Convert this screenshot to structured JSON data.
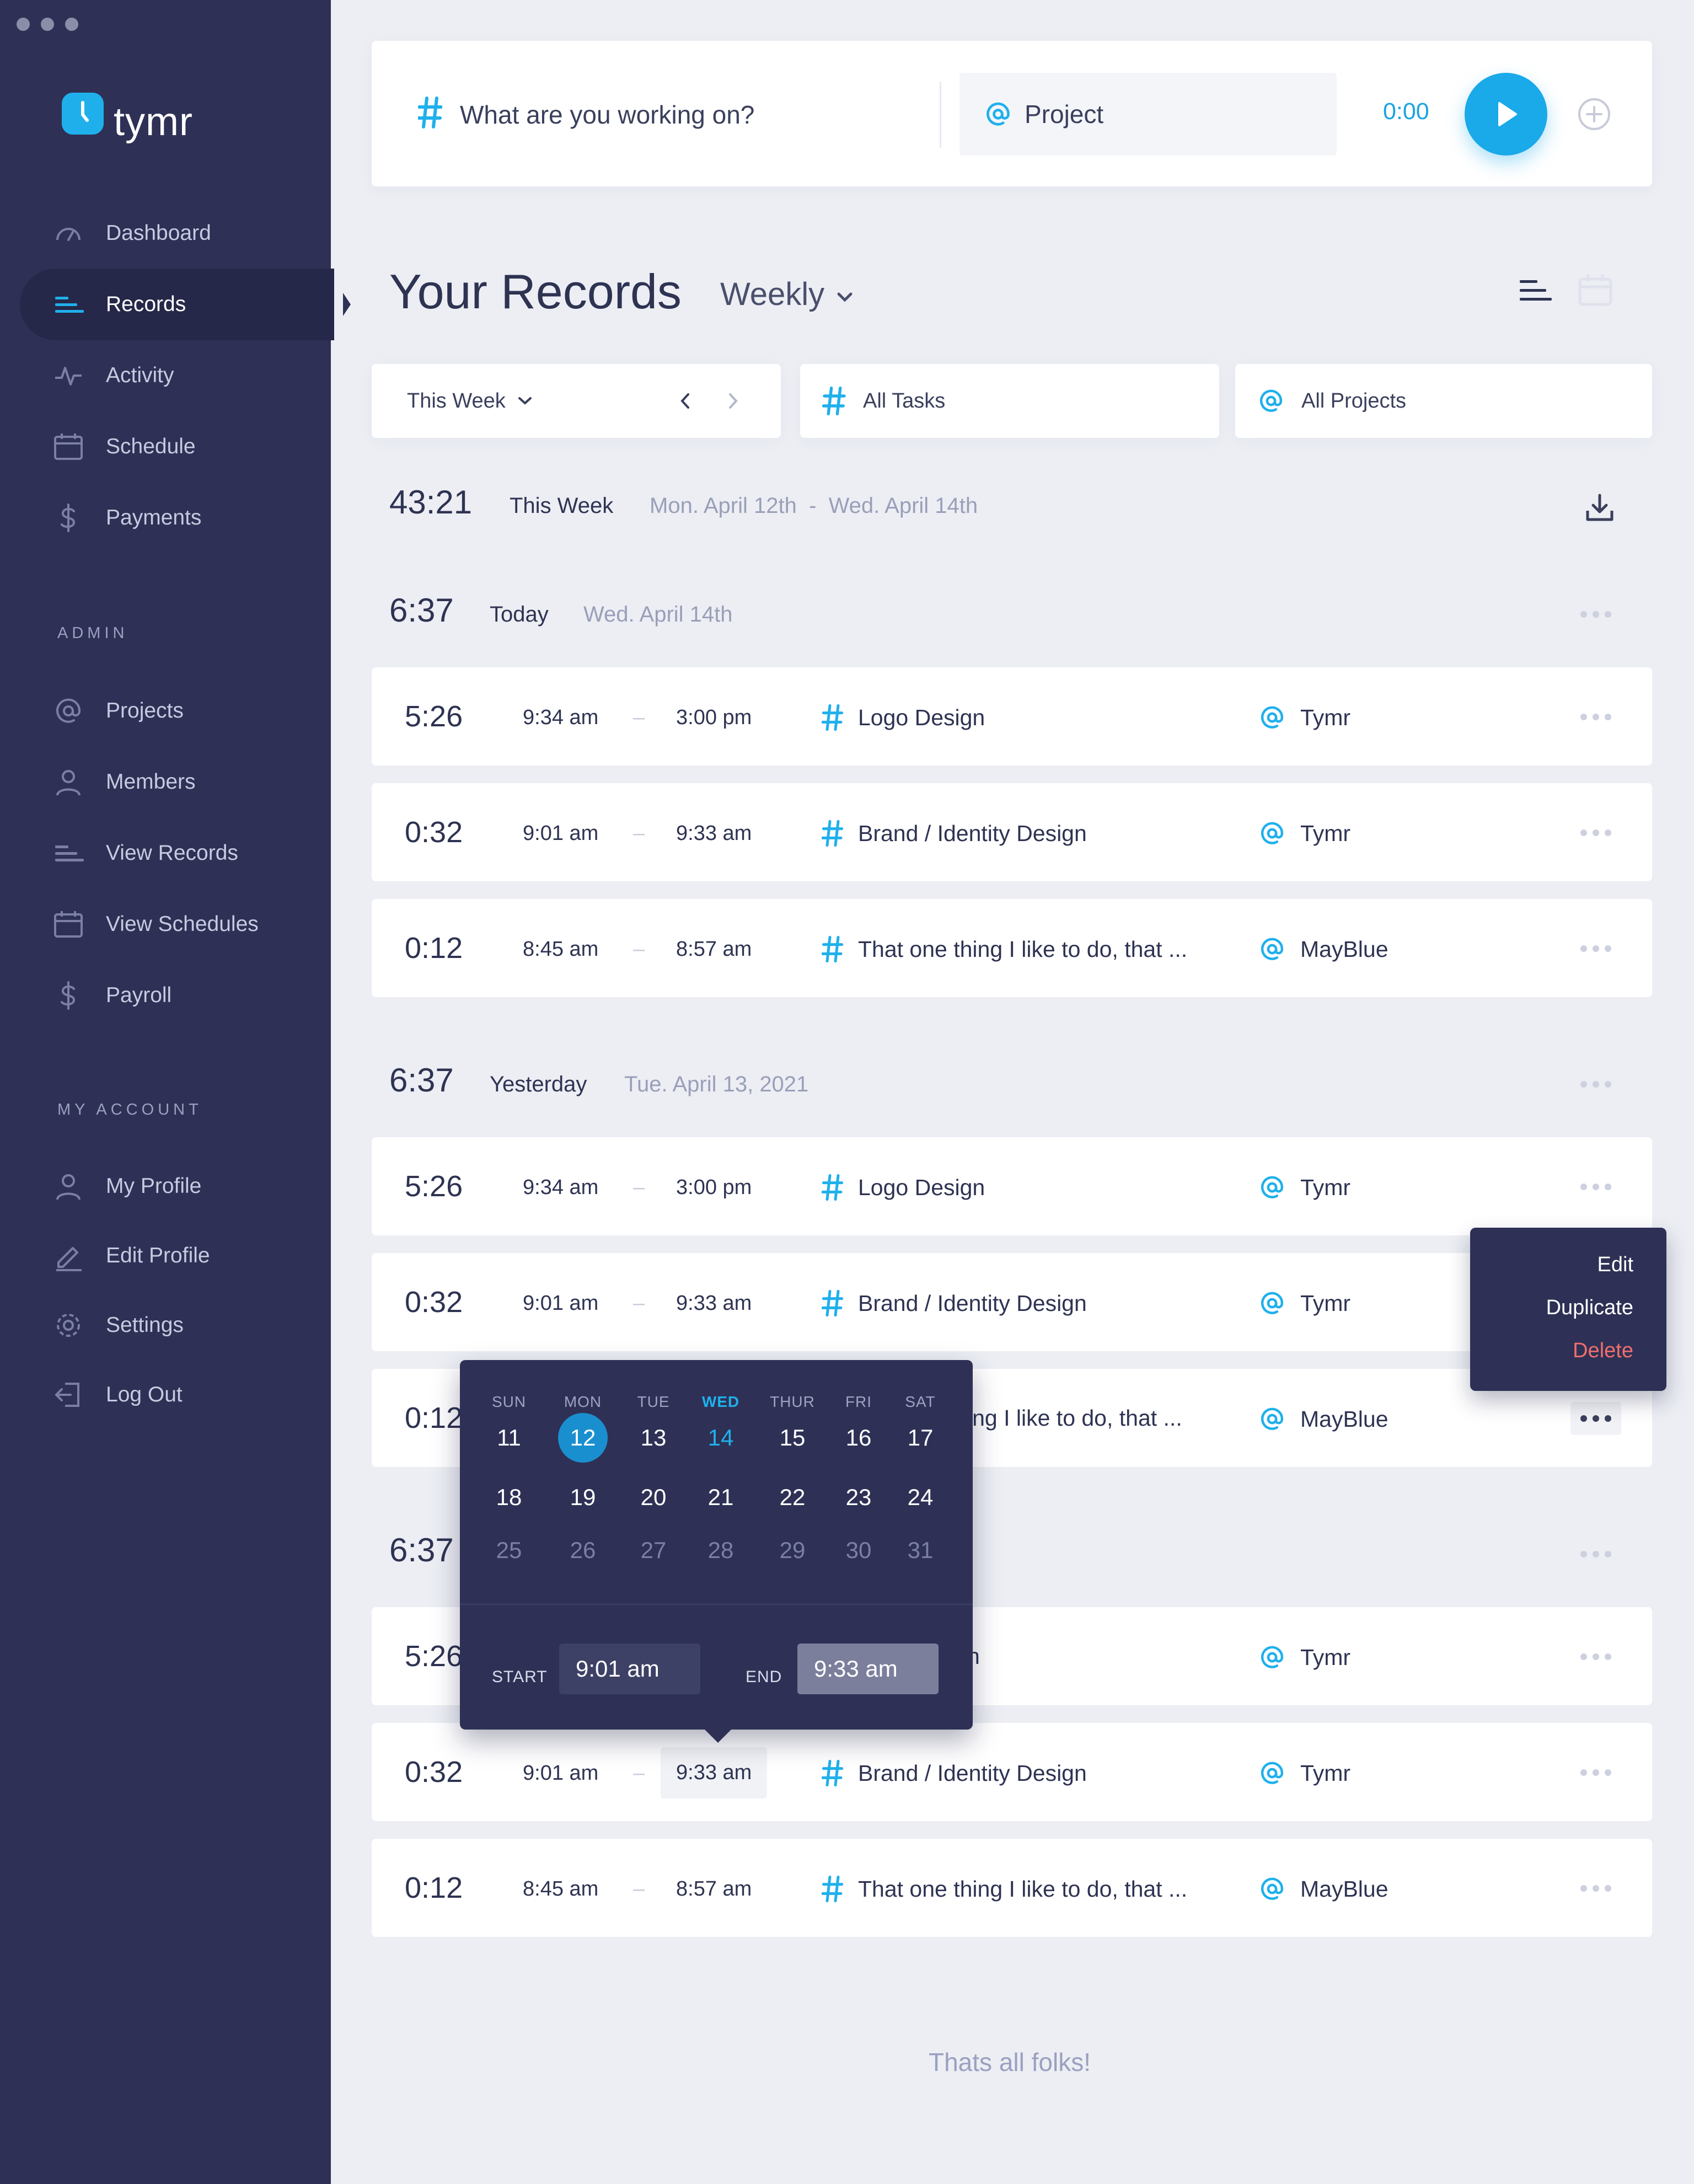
{
  "app": {
    "name": "tymr"
  },
  "nav": {
    "main": [
      {
        "label": "Dashboard",
        "icon": "gauge-icon"
      },
      {
        "label": "Records",
        "icon": "records-icon",
        "active": true
      },
      {
        "label": "Activity",
        "icon": "activity-icon"
      },
      {
        "label": "Schedule",
        "icon": "calendar-icon"
      },
      {
        "label": "Payments",
        "icon": "dollar-icon"
      }
    ],
    "admin_title": "ADMIN",
    "admin": [
      {
        "label": "Projects",
        "icon": "at-icon"
      },
      {
        "label": "Members",
        "icon": "user-icon"
      },
      {
        "label": "View Records",
        "icon": "records-icon"
      },
      {
        "label": "View Schedules",
        "icon": "calendar-icon"
      },
      {
        "label": "Payroll",
        "icon": "dollar-icon"
      }
    ],
    "account_title": "MY ACCOUNT",
    "account": [
      {
        "label": "My Profile",
        "icon": "user-icon"
      },
      {
        "label": "Edit Profile",
        "icon": "pencil-icon"
      },
      {
        "label": "Settings",
        "icon": "gear-icon"
      },
      {
        "label": "Log Out",
        "icon": "logout-icon"
      }
    ]
  },
  "tracker": {
    "task_placeholder": "What are you working on?",
    "project_label": "Project",
    "timer": "0:00"
  },
  "header": {
    "title": "Your Records",
    "range": "Weekly"
  },
  "filters": {
    "week": "This Week",
    "tasks": "All Tasks",
    "projects": "All Projects"
  },
  "summary": {
    "total": "43:21",
    "label": "This Week",
    "range_start": "Mon. April 12th",
    "range_sep": "-",
    "range_end": "Wed. April 14th"
  },
  "days": [
    {
      "total": "6:37",
      "label": "Today",
      "date": "Wed. April 14th",
      "records": [
        {
          "duration": "5:26",
          "start": "9:34 am",
          "end": "3:00 pm",
          "task": "Logo Design",
          "project": "Tymr"
        },
        {
          "duration": "0:32",
          "start": "9:01 am",
          "end": "9:33 am",
          "task": "Brand / Identity Design",
          "project": "Tymr"
        },
        {
          "duration": "0:12",
          "start": "8:45 am",
          "end": "8:57 am",
          "task": "That one thing I like to do, that ...",
          "project": "MayBlue"
        }
      ]
    },
    {
      "total": "6:37",
      "label": "Yesterday",
      "date": "Tue. April 13, 2021",
      "records": [
        {
          "duration": "5:26",
          "start": "9:34 am",
          "end": "3:00 pm",
          "task": "Logo Design",
          "project": "Tymr"
        },
        {
          "duration": "0:32",
          "start": "9:01 am",
          "end": "9:33 am",
          "task": "Brand / Identity Design",
          "project": "Tymr"
        },
        {
          "duration": "0:12",
          "start": "",
          "end": "",
          "task": "ing I like to do, that ...",
          "project": "MayBlue"
        }
      ]
    },
    {
      "total": "6:37",
      "label": "",
      "date": "",
      "records": [
        {
          "duration": "5:26",
          "start": "",
          "end": "",
          "task": "n",
          "project": "Tymr"
        },
        {
          "duration": "0:32",
          "start": "9:01 am",
          "end": "9:33 am",
          "task": "Brand / Identity Design",
          "project": "Tymr"
        },
        {
          "duration": "0:12",
          "start": "8:45 am",
          "end": "8:57 am",
          "task": "That one thing I like to do, that ...",
          "project": "MayBlue"
        }
      ]
    }
  ],
  "record_separator": "–",
  "context_menu": {
    "items": [
      "Edit",
      "Duplicate",
      "Delete"
    ]
  },
  "datepicker": {
    "weekdays": [
      "SUN",
      "MON",
      "TUE",
      "WED",
      "THUR",
      "FRI",
      "SAT"
    ],
    "weeks": [
      [
        "11",
        "12",
        "13",
        "14",
        "15",
        "16",
        "17"
      ],
      [
        "18",
        "19",
        "20",
        "21",
        "22",
        "23",
        "24"
      ],
      [
        "25",
        "26",
        "27",
        "28",
        "29",
        "30",
        "31"
      ]
    ],
    "selected_day": "12",
    "today_day": "14",
    "start_label": "START",
    "start_value": "9:01 am",
    "end_label": "END",
    "end_value": "9:33 am"
  },
  "footer": "Thats all folks!",
  "colors": {
    "sidebar": "#2e3155",
    "accent": "#1fb0ec",
    "danger": "#f06e6e",
    "background": "#eceef4"
  }
}
